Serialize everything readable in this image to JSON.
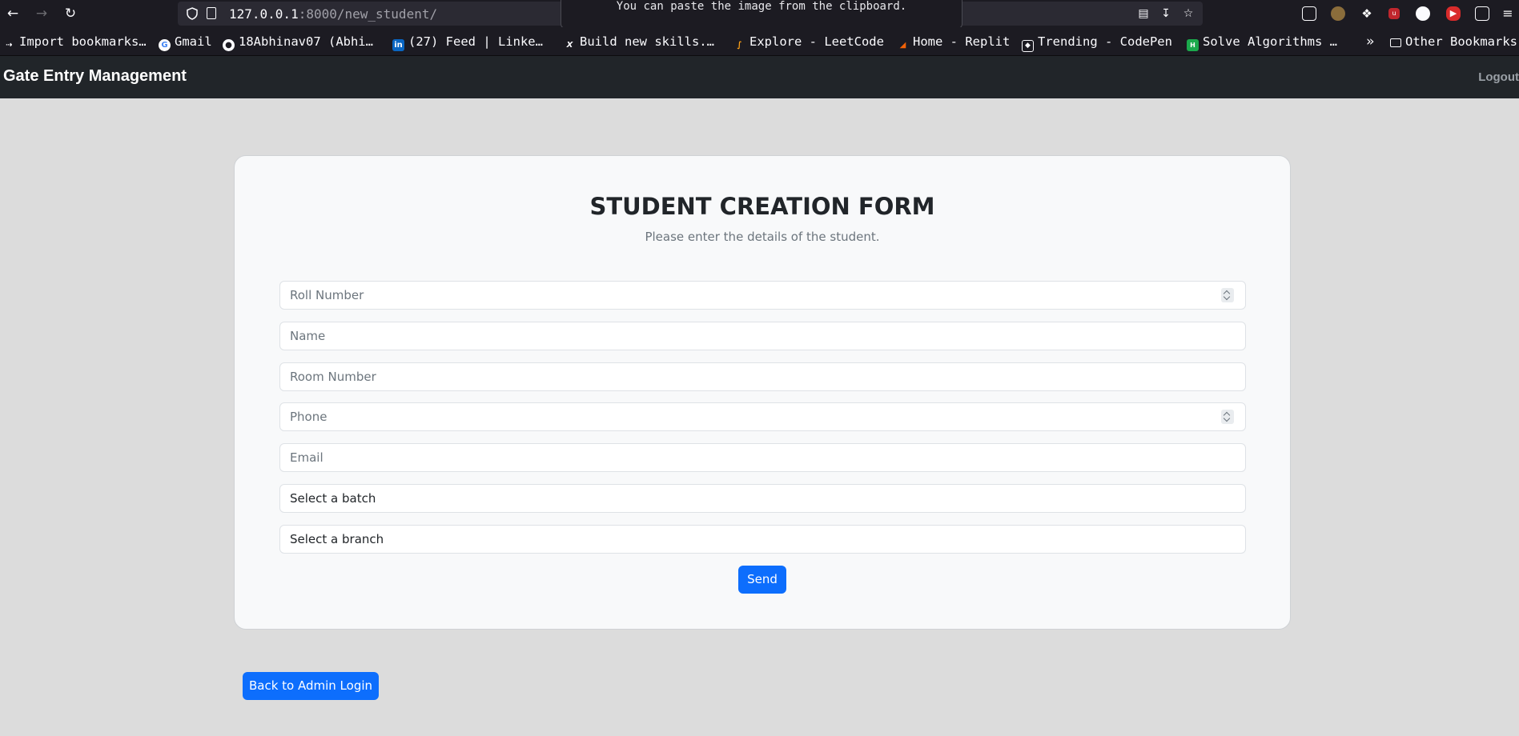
{
  "browser": {
    "url_host": "127.0.0.1",
    "url_port_path": ":8000/new_student/",
    "paste_tooltip": "You can paste the image from the clipboard.",
    "bookmarks": [
      "Import bookmarks…",
      "Gmail",
      "18Abhinav07 (Abhi…",
      "(27) Feed | Linke…",
      "Build new skills.…",
      "Explore - LeetCode",
      "Home - Replit",
      "Trending - CodePen",
      "Solve Algorithms …"
    ],
    "other_bookmarks": "Other Bookmarks"
  },
  "navbar": {
    "brand": "Gate Entry Management",
    "logout": "Logout"
  },
  "form": {
    "title": "STUDENT CREATION FORM",
    "subtitle": "Please enter the details of the student.",
    "roll_number_placeholder": "Roll Number",
    "name_placeholder": "Name",
    "room_number_placeholder": "Room Number",
    "phone_placeholder": "Phone",
    "email_placeholder": "Email",
    "batch_select": "Select a batch",
    "branch_select": "Select a branch",
    "send_label": "Send"
  },
  "back_button_label": "Back to Admin Login",
  "colors": {
    "accent": "#0d6efd",
    "navbar": "#212529",
    "page_background": "#dcdcdc",
    "card_background": "#f8f9fa"
  }
}
